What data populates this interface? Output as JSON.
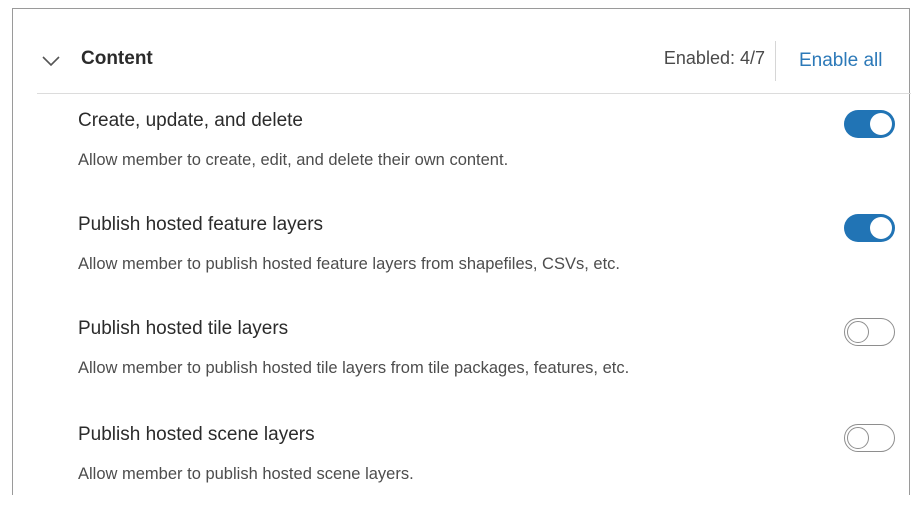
{
  "section": {
    "title": "Content",
    "enabled_count": "Enabled: 4/7",
    "enable_all_label": "Enable all",
    "chevron_icon": "chevron-down-icon",
    "accent_color": "#2174b5"
  },
  "items": [
    {
      "title": "Create, update, and delete",
      "description": "Allow member to create, edit, and delete their own content.",
      "enabled": true
    },
    {
      "title": "Publish hosted feature layers",
      "description": "Allow member to publish hosted feature layers from shapefiles, CSVs, etc.",
      "enabled": true
    },
    {
      "title": "Publish hosted tile layers",
      "description": "Allow member to publish hosted tile layers from tile packages, features, etc.",
      "enabled": false
    },
    {
      "title": "Publish hosted scene layers",
      "description": "Allow member to publish hosted scene layers.",
      "enabled": false
    }
  ]
}
